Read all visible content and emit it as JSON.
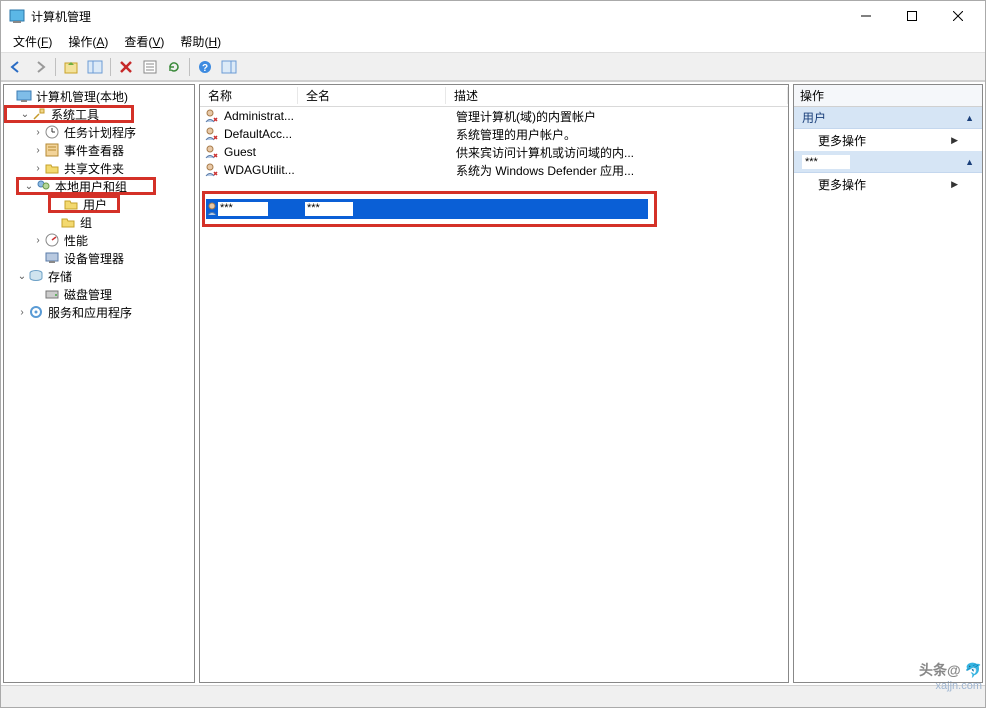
{
  "title": "计算机管理",
  "menus": {
    "file": {
      "label": "文件",
      "hotkey": "F"
    },
    "action": {
      "label": "操作",
      "hotkey": "A"
    },
    "view": {
      "label": "查看",
      "hotkey": "V"
    },
    "help": {
      "label": "帮助",
      "hotkey": "H"
    }
  },
  "tree": {
    "root": "计算机管理(本地)",
    "system_tools": "系统工具",
    "task_scheduler": "任务计划程序",
    "event_viewer": "事件查看器",
    "shared_folders": "共享文件夹",
    "local_users_groups": "本地用户和组",
    "users": "用户",
    "groups": "组",
    "performance": "性能",
    "device_manager": "设备管理器",
    "storage": "存储",
    "disk_management": "磁盘管理",
    "services_apps": "服务和应用程序"
  },
  "list": {
    "columns": {
      "name": "名称",
      "fullname": "全名",
      "description": "描述"
    },
    "rows": [
      {
        "name": "Administrat...",
        "fullname": "",
        "description": "管理计算机(域)的内置帐户"
      },
      {
        "name": "DefaultAcc...",
        "fullname": "",
        "description": "系统管理的用户帐户。"
      },
      {
        "name": "Guest",
        "fullname": "",
        "description": "供来宾访问计算机或访问域的内..."
      },
      {
        "name": "WDAGUtilit...",
        "fullname": "",
        "description": "系统为 Windows Defender 应用..."
      }
    ],
    "selected": {
      "name": "***",
      "fullname": "***",
      "description": ""
    }
  },
  "actions": {
    "header": "操作",
    "section1": "用户",
    "more1": "更多操作",
    "section2": "***",
    "more2": "更多操作"
  },
  "watermark": {
    "top": "头条@",
    "site": "xajjn.com"
  }
}
